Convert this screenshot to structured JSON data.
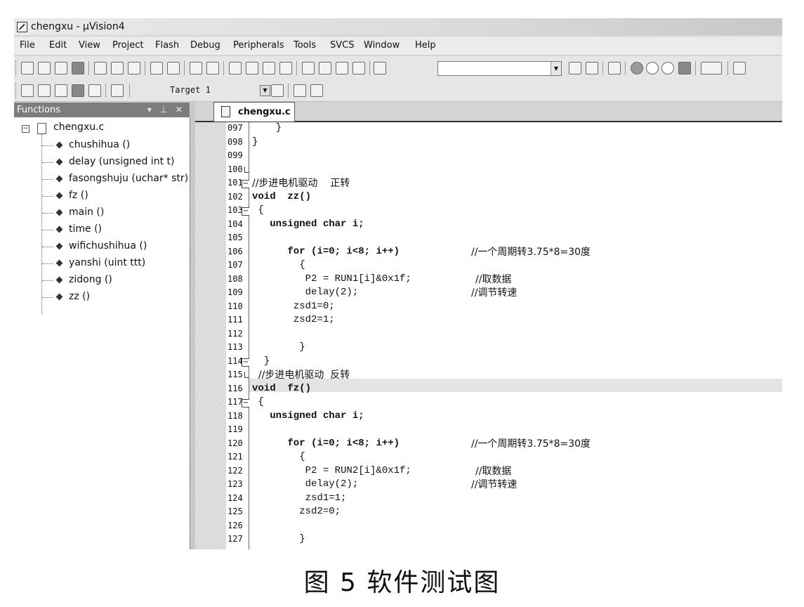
{
  "window": {
    "title": "chengxu  - µVision4",
    "app_icon": "uvision-app-icon"
  },
  "menu": [
    "File",
    "Edit",
    "View",
    "Project",
    "Flash",
    "Debug",
    "Peripherals",
    "Tools",
    "SVCS",
    "Window",
    "Help"
  ],
  "toolbar2": {
    "target": "Target 1"
  },
  "functions_panel": {
    "title": "Functions",
    "root": "chengxu.c",
    "items": [
      "chushihua ()",
      "delay (unsigned int t)",
      "fasongshuju (uchar* str)",
      "fz ()",
      "main ()",
      "time ()",
      "wifichushihua ()",
      "yanshi (uint ttt)",
      "zidong ()",
      "zz ()"
    ]
  },
  "editor": {
    "tab": "chengxu.c",
    "lines": [
      {
        "n": "097",
        "code": "    }",
        "comment": ""
      },
      {
        "n": "098",
        "code": "}",
        "comment": ""
      },
      {
        "n": "099",
        "code": "",
        "comment": ""
      },
      {
        "n": "100",
        "code": "",
        "comment": ""
      },
      {
        "n": "101",
        "code": "",
        "comment": "//步进电机驱动    正转"
      },
      {
        "n": "102",
        "code": "void  zz()",
        "comment": ""
      },
      {
        "n": "103",
        "code": " {",
        "comment": ""
      },
      {
        "n": "104",
        "code": "   unsigned char i;",
        "comment": ""
      },
      {
        "n": "105",
        "code": "",
        "comment": ""
      },
      {
        "n": "106",
        "code": "      for (i=0; i<8; i++)",
        "comment": "//一个周期转3.75*8=30度"
      },
      {
        "n": "107",
        "code": "        {",
        "comment": ""
      },
      {
        "n": "108",
        "code": "         P2 = RUN1[i]&0x1f;",
        "comment": "//取数据"
      },
      {
        "n": "109",
        "code": "         delay(2);",
        "comment": "//调节转速"
      },
      {
        "n": "110",
        "code": "       zsd1=0;",
        "comment": ""
      },
      {
        "n": "111",
        "code": "       zsd2=1;",
        "comment": ""
      },
      {
        "n": "112",
        "code": "",
        "comment": ""
      },
      {
        "n": "113",
        "code": "        }",
        "comment": ""
      },
      {
        "n": "114",
        "code": "  }",
        "comment": ""
      },
      {
        "n": "115",
        "code": "",
        "comment": "  //步进电机驱动  反转"
      },
      {
        "n": "116",
        "code": "void  fz()",
        "comment": ""
      },
      {
        "n": "117",
        "code": " {",
        "comment": ""
      },
      {
        "n": "118",
        "code": "   unsigned char i;",
        "comment": ""
      },
      {
        "n": "119",
        "code": "",
        "comment": ""
      },
      {
        "n": "120",
        "code": "      for (i=0; i<8; i++)",
        "comment": "//一个周期转3.75*8=30度"
      },
      {
        "n": "121",
        "code": "        {",
        "comment": ""
      },
      {
        "n": "122",
        "code": "         P2 = RUN2[i]&0x1f;",
        "comment": "//取数据"
      },
      {
        "n": "123",
        "code": "         delay(2);",
        "comment": "//调节转速"
      },
      {
        "n": "124",
        "code": "         zsd1=1;",
        "comment": ""
      },
      {
        "n": "125",
        "code": "        zsd2=0;",
        "comment": ""
      },
      {
        "n": "126",
        "code": "",
        "comment": ""
      },
      {
        "n": "127",
        "code": "        }",
        "comment": ""
      }
    ]
  },
  "caption": "图 5   软件测试图"
}
